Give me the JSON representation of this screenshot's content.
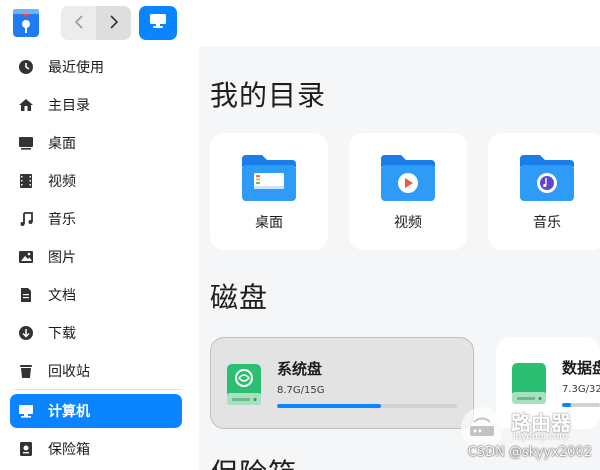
{
  "colors": {
    "accent": "#0a84ff",
    "sidebar_bg": "#ffffff",
    "content_bg": "#f5f6f8"
  },
  "topbar": {
    "logo_icon": "file-manager-logo-icon",
    "back_icon": "chevron-left-icon",
    "forward_icon": "chevron-right-icon",
    "view_icon": "monitor-icon"
  },
  "sidebar": {
    "items": [
      {
        "label": "最近使用",
        "icon": "clock-icon"
      },
      {
        "label": "主目录",
        "icon": "home-icon"
      },
      {
        "label": "桌面",
        "icon": "desktop-icon"
      },
      {
        "label": "视频",
        "icon": "film-icon"
      },
      {
        "label": "音乐",
        "icon": "music-note-icon"
      },
      {
        "label": "图片",
        "icon": "image-icon"
      },
      {
        "label": "文档",
        "icon": "document-icon"
      },
      {
        "label": "下载",
        "icon": "download-icon"
      },
      {
        "label": "回收站",
        "icon": "trash-icon"
      },
      {
        "label": "计算机",
        "icon": "computer-icon",
        "active": true
      },
      {
        "label": "保险箱",
        "icon": "safe-icon"
      }
    ]
  },
  "main": {
    "my_directory_title": "我的目录",
    "directories": [
      {
        "label": "桌面",
        "icon": "desktop-folder-icon"
      },
      {
        "label": "视频",
        "icon": "video-folder-icon"
      },
      {
        "label": "音乐",
        "icon": "music-folder-icon"
      }
    ],
    "disks_title": "磁盘",
    "disks": [
      {
        "name": "系统盘",
        "usage": "8.7G/15G",
        "used_fraction": 0.58,
        "icon": "system-disk-icon"
      },
      {
        "name": "数据盘",
        "usage": "7.3G/32",
        "used_fraction": 0.23,
        "icon": "data-disk-icon"
      }
    ],
    "vault_title": "保险箱"
  },
  "watermark": {
    "brand": "路由器",
    "site": "luyouqi.com",
    "csdn": "CSDN @skyyx2002"
  }
}
